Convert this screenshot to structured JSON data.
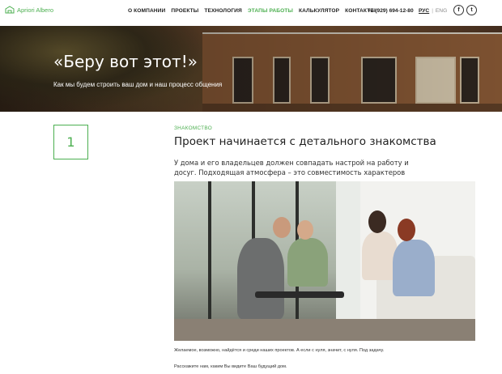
{
  "header": {
    "logo_text": "Apriori Albero",
    "nav": [
      {
        "label": "О КОМПАНИИ",
        "active": false
      },
      {
        "label": "ПРОЕКТЫ",
        "active": false
      },
      {
        "label": "ТЕХНОЛОГИЯ",
        "active": false
      },
      {
        "label": "ЭТАПЫ РАБОТЫ",
        "active": true
      },
      {
        "label": "КАЛЬКУЛЯТОР",
        "active": false
      },
      {
        "label": "КОНТАКТЫ",
        "active": false
      }
    ],
    "phone": "+7 (929) 694-12-80",
    "lang_ru": "РУС",
    "lang_sep": "|",
    "lang_en": "ENG",
    "social_fb": "f",
    "social_tw": "t",
    "accent_color": "#4caf50"
  },
  "hero": {
    "title": "«Беру вот этот!»",
    "subtitle": "Как мы будем строить ваш дом и наш процесс общения"
  },
  "step": {
    "number": "1",
    "eyebrow": "ЗНАКОМСТВО",
    "title": "Проект начинается с детального знакомства",
    "lead": "У дома и его владельцев должен совпадать настрой на работу и досуг. Подходящая атмосфера – это совместимость характеров",
    "caption": "Желаемое, возможно, найдётся и среди наших проектов. А если с нуля, значит, с нуля. Под задачу.",
    "caption2": "Расскажите нам, каким Вы видите Ваш будущий дом."
  }
}
